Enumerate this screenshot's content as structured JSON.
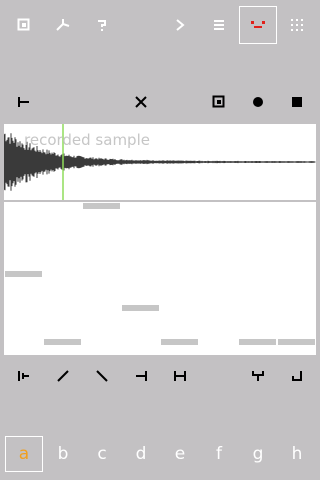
{
  "colors": {
    "background": "#c3c1c3",
    "icon": "#ffffff",
    "accent_red": "#e0201a",
    "accent_orange": "#f0a020",
    "waveform": "#3a3a3a",
    "playhead": "#8fdc5a",
    "step": "#c6c6c6"
  },
  "top_toolbar": {
    "items": [
      "window-icon",
      "fork-icon",
      "question-icon",
      "chevron-right-icon",
      "menu-icon",
      "face-icon",
      "grid-icon"
    ],
    "selected": "face-icon"
  },
  "edit_toolbar": {
    "items": [
      "trim-start-icon",
      "close-x-icon",
      "window-icon",
      "record-dot-icon",
      "stop-square-icon"
    ]
  },
  "waveform": {
    "label": "recorded sample",
    "playhead_position": 0.19
  },
  "sequencer": {
    "rows": 9,
    "columns": 8,
    "steps": [
      {
        "column": 2,
        "row": 0
      },
      {
        "column": 0,
        "row": 2
      },
      {
        "column": 3,
        "row": 3
      },
      {
        "column": 1,
        "row": 4
      },
      {
        "column": 4,
        "row": 4
      },
      {
        "column": 6,
        "row": 4
      },
      {
        "column": 7,
        "row": 4
      }
    ]
  },
  "shape_toolbar": {
    "items": [
      "loop-start-icon",
      "ramp-up-icon",
      "ramp-down-icon",
      "cut-end-icon",
      "hold-icon",
      "fork-down-icon",
      "return-icon"
    ]
  },
  "banks": {
    "letters": [
      "a",
      "b",
      "c",
      "d",
      "e",
      "f",
      "g",
      "h"
    ],
    "selected": "a"
  }
}
